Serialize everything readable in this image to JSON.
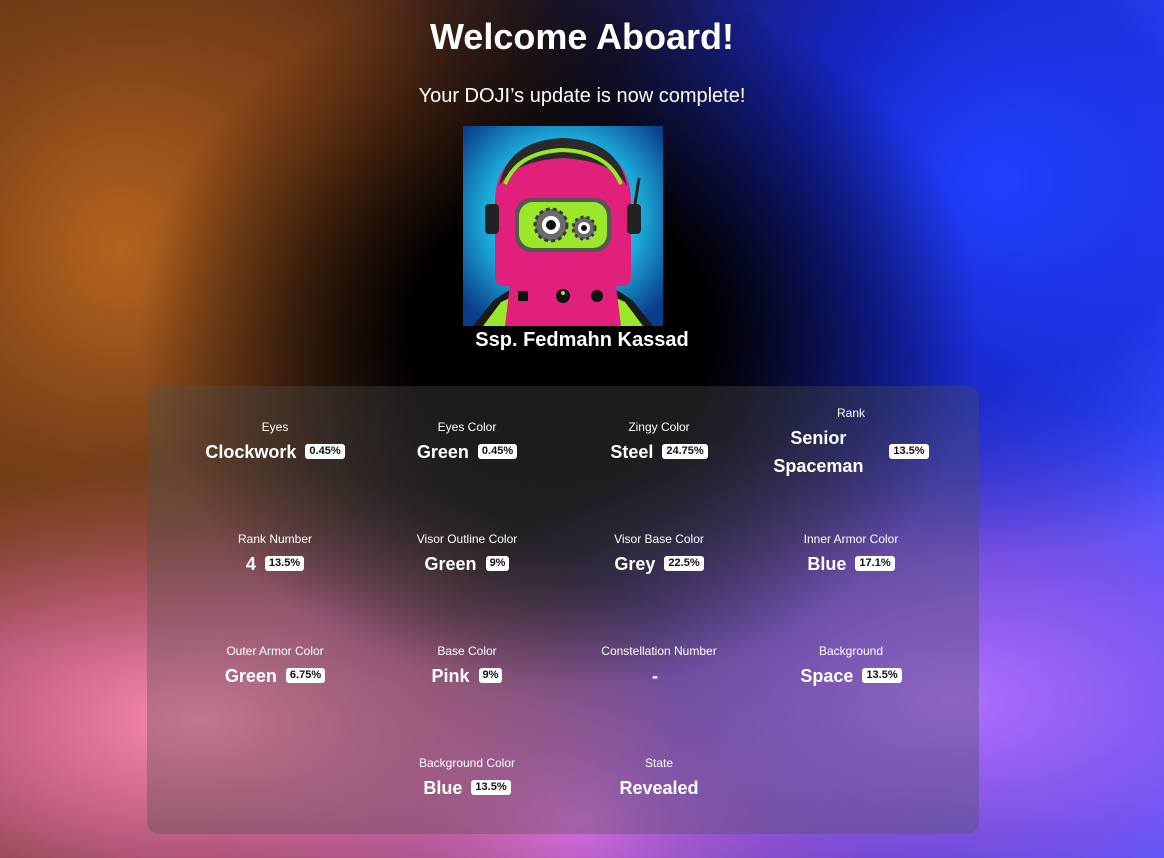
{
  "header": {
    "title": "Welcome Aboard!",
    "subtitle": "Your DOJI’s update is now complete!"
  },
  "character": {
    "name": "Ssp. Fedmahn Kassad",
    "avatar_icon": "astronaut-robot-portrait",
    "colors": {
      "background": "#1ba9d8",
      "suit": "#e0207a",
      "armor": "#9be82a",
      "helmet": "#2a2a2a"
    }
  },
  "traits": [
    {
      "label": "Eyes",
      "value": "Clockwork",
      "rarity": "0.45%"
    },
    {
      "label": "Eyes Color",
      "value": "Green",
      "rarity": "0.45%"
    },
    {
      "label": "Zingy Color",
      "value": "Steel",
      "rarity": "24.75%"
    },
    {
      "label": "Rank",
      "value": "Senior Spaceman",
      "rarity": "13.5%"
    },
    {
      "label": "Rank Number",
      "value": "4",
      "rarity": "13.5%"
    },
    {
      "label": "Visor Outline Color",
      "value": "Green",
      "rarity": "9%"
    },
    {
      "label": "Visor Base Color",
      "value": "Grey",
      "rarity": "22.5%"
    },
    {
      "label": "Inner Armor Color",
      "value": "Blue",
      "rarity": "17.1%"
    },
    {
      "label": "Outer Armor Color",
      "value": "Green",
      "rarity": "6.75%"
    },
    {
      "label": "Base Color",
      "value": "Pink",
      "rarity": "9%"
    },
    {
      "label": "Constellation Number",
      "value": "-",
      "rarity": null
    },
    {
      "label": "Background",
      "value": "Space",
      "rarity": "13.5%"
    },
    {
      "label": "Background Color",
      "value": "Blue",
      "rarity": "13.5%"
    },
    {
      "label": "State",
      "value": "Revealed",
      "rarity": null
    }
  ]
}
